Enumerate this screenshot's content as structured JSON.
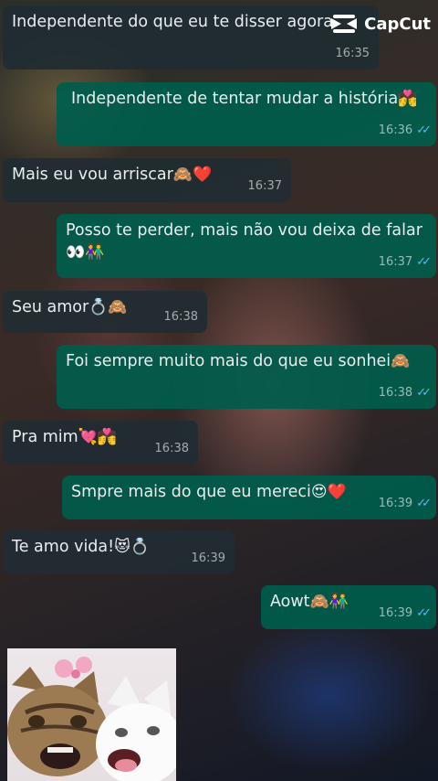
{
  "watermark": {
    "text": "CapCut"
  },
  "messages": [
    {
      "dir": "in",
      "text": "Independente do que eu te disser agora",
      "emoji": "",
      "time": "16:35"
    },
    {
      "dir": "out",
      "text": "Independente de tentar mudar a história",
      "emoji": "💏",
      "time": "16:36"
    },
    {
      "dir": "in",
      "text": "Mais eu vou arriscar",
      "emoji": "🙈❤️",
      "time": "16:37"
    },
    {
      "dir": "out",
      "text": "Posso te perder, mais não vou deixa de falar",
      "emoji": "👀👫",
      "time": "16:37"
    },
    {
      "dir": "in",
      "text": "Seu amor",
      "emoji": "💍🙈",
      "time": "16:38"
    },
    {
      "dir": "out",
      "text": "Foi sempre muito mais do que eu sonhei",
      "emoji": "🙈",
      "time": "16:38"
    },
    {
      "dir": "in",
      "text": "Pra mim",
      "emoji": "💘💏",
      "time": "16:38"
    },
    {
      "dir": "out",
      "text": "Smpre mais do que eu mereci",
      "emoji": "😍❤️",
      "time": "16:39"
    },
    {
      "dir": "in",
      "text": "Te amo vida!",
      "emoji": "😻💍",
      "time": "16:39"
    },
    {
      "dir": "out",
      "text": "Aowt",
      "emoji": "🙈👫",
      "time": "16:39"
    }
  ],
  "sticker": {
    "description_icon": "cats-kiss-sticker"
  },
  "colors": {
    "incoming": "#202c33",
    "outgoing": "#005c4b",
    "read_ticks": "#53bdeb"
  }
}
